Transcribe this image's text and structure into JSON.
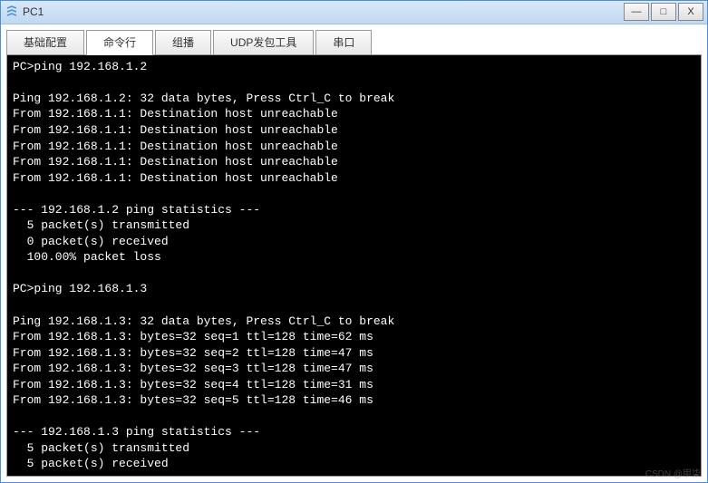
{
  "window": {
    "title": "PC1",
    "controls": {
      "minimize": "—",
      "maximize": "□",
      "close": "X"
    }
  },
  "tabs": [
    {
      "label": "基础配置",
      "active": false
    },
    {
      "label": "命令行",
      "active": true
    },
    {
      "label": "组播",
      "active": false
    },
    {
      "label": "UDP发包工具",
      "active": false
    },
    {
      "label": "串口",
      "active": false
    }
  ],
  "terminal_lines": [
    "PC>ping 192.168.1.2",
    "",
    "Ping 192.168.1.2: 32 data bytes, Press Ctrl_C to break",
    "From 192.168.1.1: Destination host unreachable",
    "From 192.168.1.1: Destination host unreachable",
    "From 192.168.1.1: Destination host unreachable",
    "From 192.168.1.1: Destination host unreachable",
    "From 192.168.1.1: Destination host unreachable",
    "",
    "--- 192.168.1.2 ping statistics ---",
    "  5 packet(s) transmitted",
    "  0 packet(s) received",
    "  100.00% packet loss",
    "",
    "PC>ping 192.168.1.3",
    "",
    "Ping 192.168.1.3: 32 data bytes, Press Ctrl_C to break",
    "From 192.168.1.3: bytes=32 seq=1 ttl=128 time=62 ms",
    "From 192.168.1.3: bytes=32 seq=2 ttl=128 time=47 ms",
    "From 192.168.1.3: bytes=32 seq=3 ttl=128 time=47 ms",
    "From 192.168.1.3: bytes=32 seq=4 ttl=128 time=31 ms",
    "From 192.168.1.3: bytes=32 seq=5 ttl=128 time=46 ms",
    "",
    "--- 192.168.1.3 ping statistics ---",
    "  5 packet(s) transmitted",
    "  5 packet(s) received"
  ],
  "watermark": "CSDN @甲柒"
}
